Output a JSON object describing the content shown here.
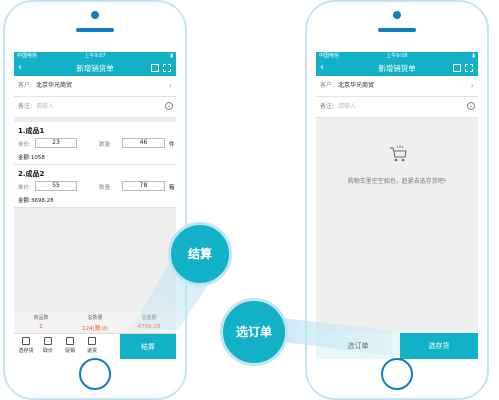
{
  "left_phone": {
    "status": {
      "carrier": "中国电信",
      "time": "上午9:07",
      "battery": "▮"
    },
    "nav_title": "新增销货单",
    "customer": {
      "label": "客户:",
      "value": "北京华光商贸"
    },
    "remark": {
      "label": "备注:",
      "placeholder": "请输入"
    },
    "items": [
      {
        "name": "1.成品1",
        "unit_label": "单价:",
        "unit_price": "23",
        "qty_label": "数量:",
        "qty": "46",
        "unit": "件",
        "amount_label": "金额:",
        "amount": "1058"
      },
      {
        "name": "2.成品2",
        "unit_label": "单价:",
        "unit_price": "55",
        "qty_label": "数量:",
        "qty": "78",
        "unit": "箱",
        "amount_label": "金额:",
        "amount": "3698.28"
      }
    ],
    "summary": [
      {
        "label": "商品数",
        "value": "2"
      },
      {
        "label": "总数量",
        "value": "124(赠:0)"
      },
      {
        "label": "总金额",
        "value": "4756.28"
      }
    ],
    "toolbar": [
      {
        "label": "选存货",
        "icon": "select-stock-icon"
      },
      {
        "label": "取价",
        "icon": "price-icon"
      },
      {
        "label": "促销",
        "icon": "promotion-icon"
      },
      {
        "label": "退货",
        "icon": "return-icon"
      }
    ],
    "settle_button": "结算"
  },
  "right_phone": {
    "status": {
      "carrier": "中国电信",
      "time": "上午9:08",
      "battery": "▮"
    },
    "nav_title": "新增销货单",
    "customer": {
      "label": "客户:",
      "value": "北京华光商贸"
    },
    "remark": {
      "label": "备注:",
      "placeholder": "请输入"
    },
    "empty_message": "购物车里空空如也，赶紧去选存货吧!",
    "select_order_button": "选订单",
    "select_stock_button": "选存货"
  },
  "callouts": {
    "settle": "结算",
    "select_order": "选订单"
  },
  "colors": {
    "accent": "#12b1c8",
    "amount": "#ff5a1f",
    "phone_frame": "#0f7fc0"
  }
}
